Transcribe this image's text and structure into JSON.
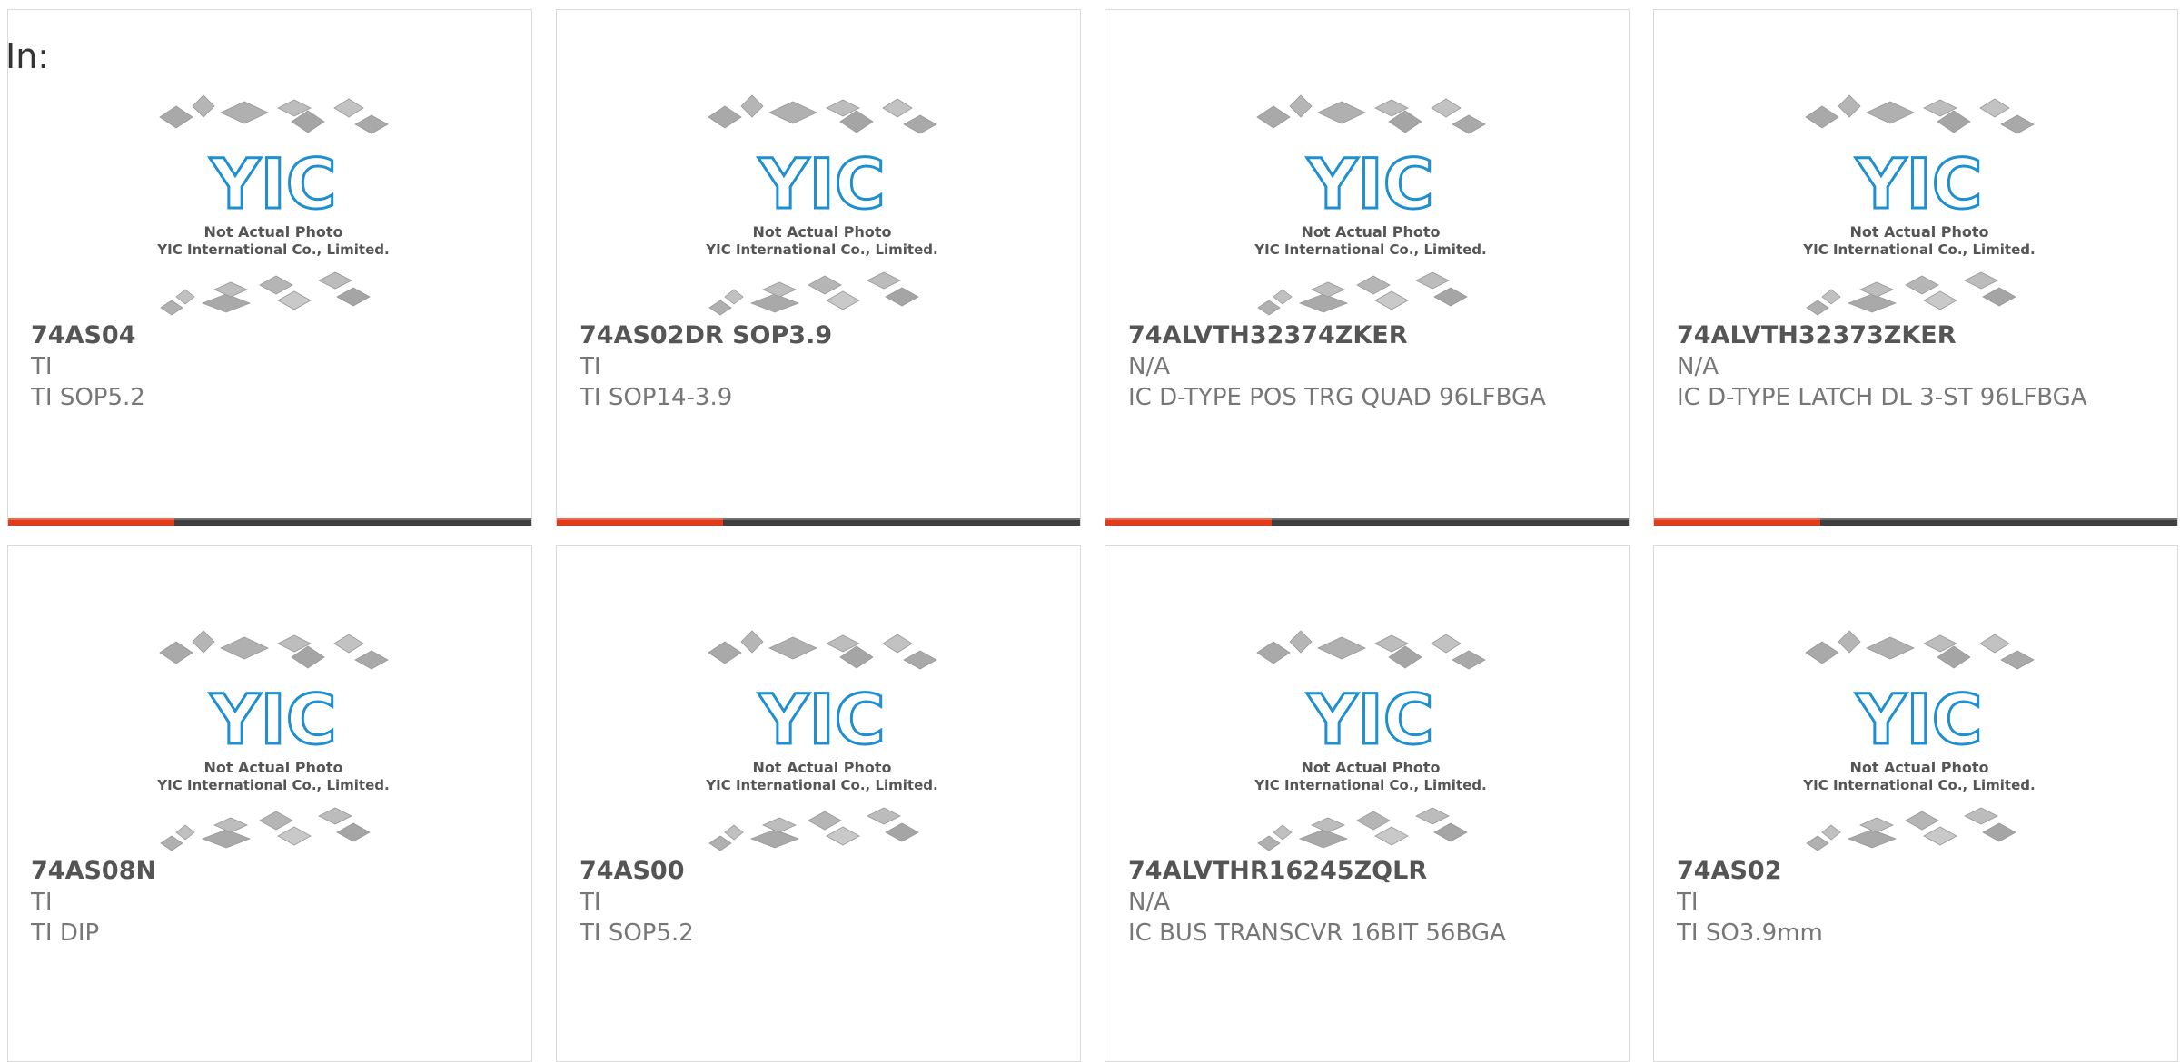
{
  "header": {
    "label": "In:"
  },
  "image_caption": {
    "line1": "Not Actual Photo",
    "line2": "YIC International Co., Limited.",
    "logo_text": "YIC"
  },
  "colors": {
    "accent": "#e53918",
    "bar": "#3f3f3f",
    "logo": "#1e8fd0",
    "border": "#d9d9d9"
  },
  "products": [
    {
      "part": "74AS04",
      "mfr": "TI",
      "desc": "TI SOP5.2"
    },
    {
      "part": "74AS02DR SOP3.9",
      "mfr": "TI",
      "desc": "TI SOP14-3.9"
    },
    {
      "part": "74ALVTH32374ZKER",
      "mfr": "N/A",
      "desc": "IC D-TYPE POS TRG QUAD 96LFBGA"
    },
    {
      "part": "74ALVTH32373ZKER",
      "mfr": "N/A",
      "desc": "IC D-TYPE LATCH DL 3-ST 96LFBGA"
    },
    {
      "part": "74AS08N",
      "mfr": "TI",
      "desc": "TI DIP"
    },
    {
      "part": "74AS00",
      "mfr": "TI",
      "desc": "TI SOP5.2"
    },
    {
      "part": "74ALVTHR16245ZQLR",
      "mfr": "N/A",
      "desc": "IC BUS TRANSCVR 16BIT 56BGA"
    },
    {
      "part": "74AS02",
      "mfr": "TI",
      "desc": "TI SO3.9mm"
    }
  ]
}
